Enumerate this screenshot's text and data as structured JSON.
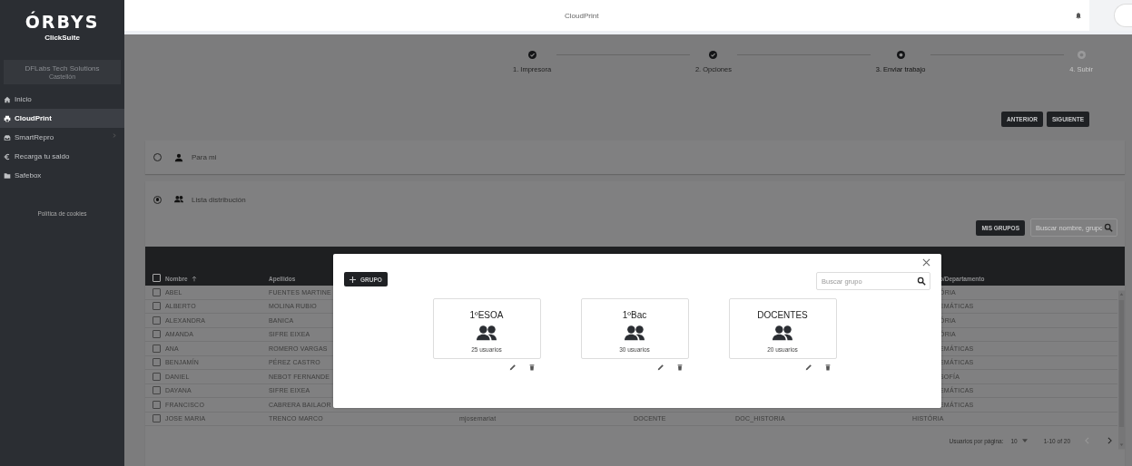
{
  "sidebar": {
    "logo": "ÓRBYS",
    "product": "ClickSuite",
    "organization": {
      "name": "DFLabs Tech Solutions",
      "location": "Castellón"
    },
    "items": [
      {
        "kind": "home",
        "label": "Inicio",
        "selected": false,
        "has_submenu": false
      },
      {
        "kind": "printer",
        "label": "CloudPrint",
        "selected": true,
        "has_submenu": false
      },
      {
        "kind": "tray",
        "label": "SmartRepro",
        "selected": false,
        "has_submenu": true
      },
      {
        "kind": "euro",
        "label": "Recarga tu saldo",
        "selected": false,
        "has_submenu": false
      },
      {
        "kind": "folder",
        "label": "Safebox",
        "selected": false,
        "has_submenu": false
      }
    ],
    "footer_link": "Política de cookies"
  },
  "header": {
    "title": "CloudPrint"
  },
  "stepper": [
    {
      "label": "1. Impresora",
      "completed": true,
      "active": false
    },
    {
      "label": "2. Opciones",
      "completed": true,
      "active": false
    },
    {
      "label": "3. Enviar trabajo",
      "completed": false,
      "active": true
    },
    {
      "label": "4. Subir",
      "completed": false,
      "active": false
    }
  ],
  "nav_buttons": [
    "ANTERIOR",
    "SIGUIENTE"
  ],
  "recipient_options": [
    {
      "kind": "person",
      "label": "Para mi",
      "selected": false
    },
    {
      "kind": "group",
      "label": "Lista distribución",
      "selected": true
    }
  ],
  "groups_button": "MIS GRUPOS",
  "search": {
    "placeholder": "Buscar nombre, grupo"
  },
  "table": {
    "select_all_checked": false,
    "columns": [
      {
        "label": "Nombre",
        "sorted_ascending": true
      },
      {
        "label": "Apellidos",
        "sorted_ascending": false
      },
      {
        "label": "o/Departamento",
        "sorted_ascending": false
      }
    ],
    "rows": [
      {
        "checked": false,
        "nombre": "ABEL",
        "apellidos": "FUENTES MARTINE",
        "column_6": "ÓRIA"
      },
      {
        "checked": false,
        "nombre": "ALBERTO",
        "apellidos": "MOLINA RUBIO",
        "column_6": "EMÁTICAS"
      },
      {
        "checked": false,
        "nombre": "ALEXANDRA",
        "apellidos": "BANICA",
        "column_6": "ÓRIA"
      },
      {
        "checked": false,
        "nombre": "AMANDA",
        "apellidos": "SIFRE EIXEA",
        "column_6": "ÓRIA"
      },
      {
        "checked": false,
        "nombre": "ANA",
        "apellidos": "ROMERO VARGAS",
        "column_6": "EMÁTICAS"
      },
      {
        "checked": false,
        "nombre": "BENJAMÍN",
        "apellidos": "PÉREZ CASTRO",
        "column_6": "EMÁTICAS"
      },
      {
        "checked": false,
        "nombre": "DANIEL",
        "apellidos": "NEBOT FERNANDE",
        "column_6": "SOFÍA"
      },
      {
        "checked": false,
        "nombre": "DAYANA",
        "apellidos": "SIFRE EIXEA",
        "column_6": "EMÁTICAS"
      },
      {
        "checked": false,
        "nombre": "FRANCISCO",
        "apellidos": "CABRERA BAILAOR",
        "column_6": "EMÁTICAS"
      },
      {
        "checked": false,
        "nombre": "JOSE MARIA",
        "apellidos": "TRENCO MARCO",
        "column_3": "mjosemariat",
        "column_4": "DOCENTE",
        "column_5": "DOC_HISTORIA",
        "column_6": "HISTÓRIA"
      }
    ]
  },
  "pagination": {
    "label": "Usuarios por página:",
    "page_size": "10",
    "range": "1-10 of 20",
    "prev_disabled": true,
    "next_disabled": false
  },
  "dialog": {
    "add_button": "GRUPO",
    "search": {
      "placeholder": "Buscar grupo"
    },
    "groups": [
      {
        "name": "1ºESOA",
        "count": "25 usuarios"
      },
      {
        "name": "1ºBac",
        "count": "30 usuarios"
      },
      {
        "name": "DOCENTES",
        "count": "20 usuarios"
      }
    ]
  }
}
